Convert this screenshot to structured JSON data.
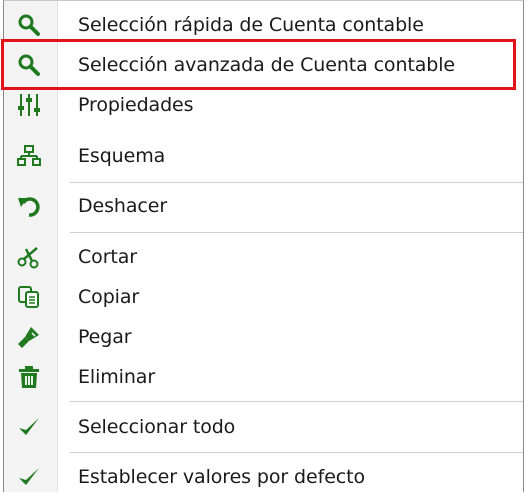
{
  "menu": {
    "items": [
      {
        "label": "Selección rápida de Cuenta contable",
        "icon": "search-icon"
      },
      {
        "label": "Selección avanzada de Cuenta contable",
        "icon": "search-icon"
      },
      {
        "label": "Propiedades",
        "icon": "sliders-icon"
      },
      {
        "label": "Esquema",
        "icon": "hierarchy-icon"
      },
      {
        "label": "Deshacer",
        "icon": "undo-icon"
      },
      {
        "label": "Cortar",
        "icon": "scissors-icon"
      },
      {
        "label": "Copiar",
        "icon": "copy-icon"
      },
      {
        "label": "Pegar",
        "icon": "paste-icon"
      },
      {
        "label": "Eliminar",
        "icon": "trash-icon"
      },
      {
        "label": "Seleccionar todo",
        "icon": "check-icon"
      },
      {
        "label": "Establecer valores por defecto",
        "icon": "check-icon"
      }
    ],
    "highlighted_item": "Selección avanzada de Cuenta contable"
  },
  "colors": {
    "icon": "#1f7a1f",
    "highlight": "#e1121a",
    "text": "#1a1a1a"
  }
}
